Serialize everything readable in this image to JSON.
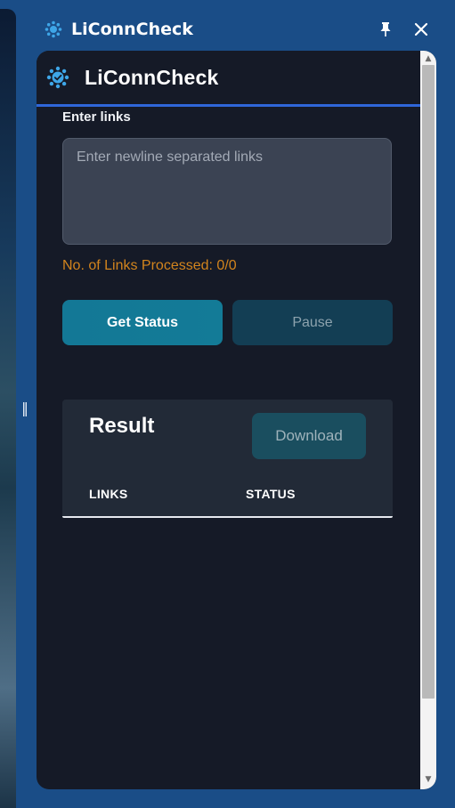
{
  "window": {
    "title": "LiConnCheck",
    "pin_icon": "pin-icon",
    "close_icon": "close-icon"
  },
  "app": {
    "title": "LiConnCheck",
    "accent_color": "#2f66d9"
  },
  "form": {
    "links_label": "Enter links",
    "links_placeholder": "Enter newline separated links",
    "links_value": "",
    "processed_label": "No. of Links Processed: ",
    "processed_value": "0/0"
  },
  "actions": {
    "get_status_label": "Get Status",
    "pause_label": "Pause"
  },
  "result": {
    "title": "Result",
    "download_label": "Download",
    "columns": [
      "LINKS",
      "STATUS"
    ],
    "rows": []
  },
  "sidebar_grip": "‖"
}
